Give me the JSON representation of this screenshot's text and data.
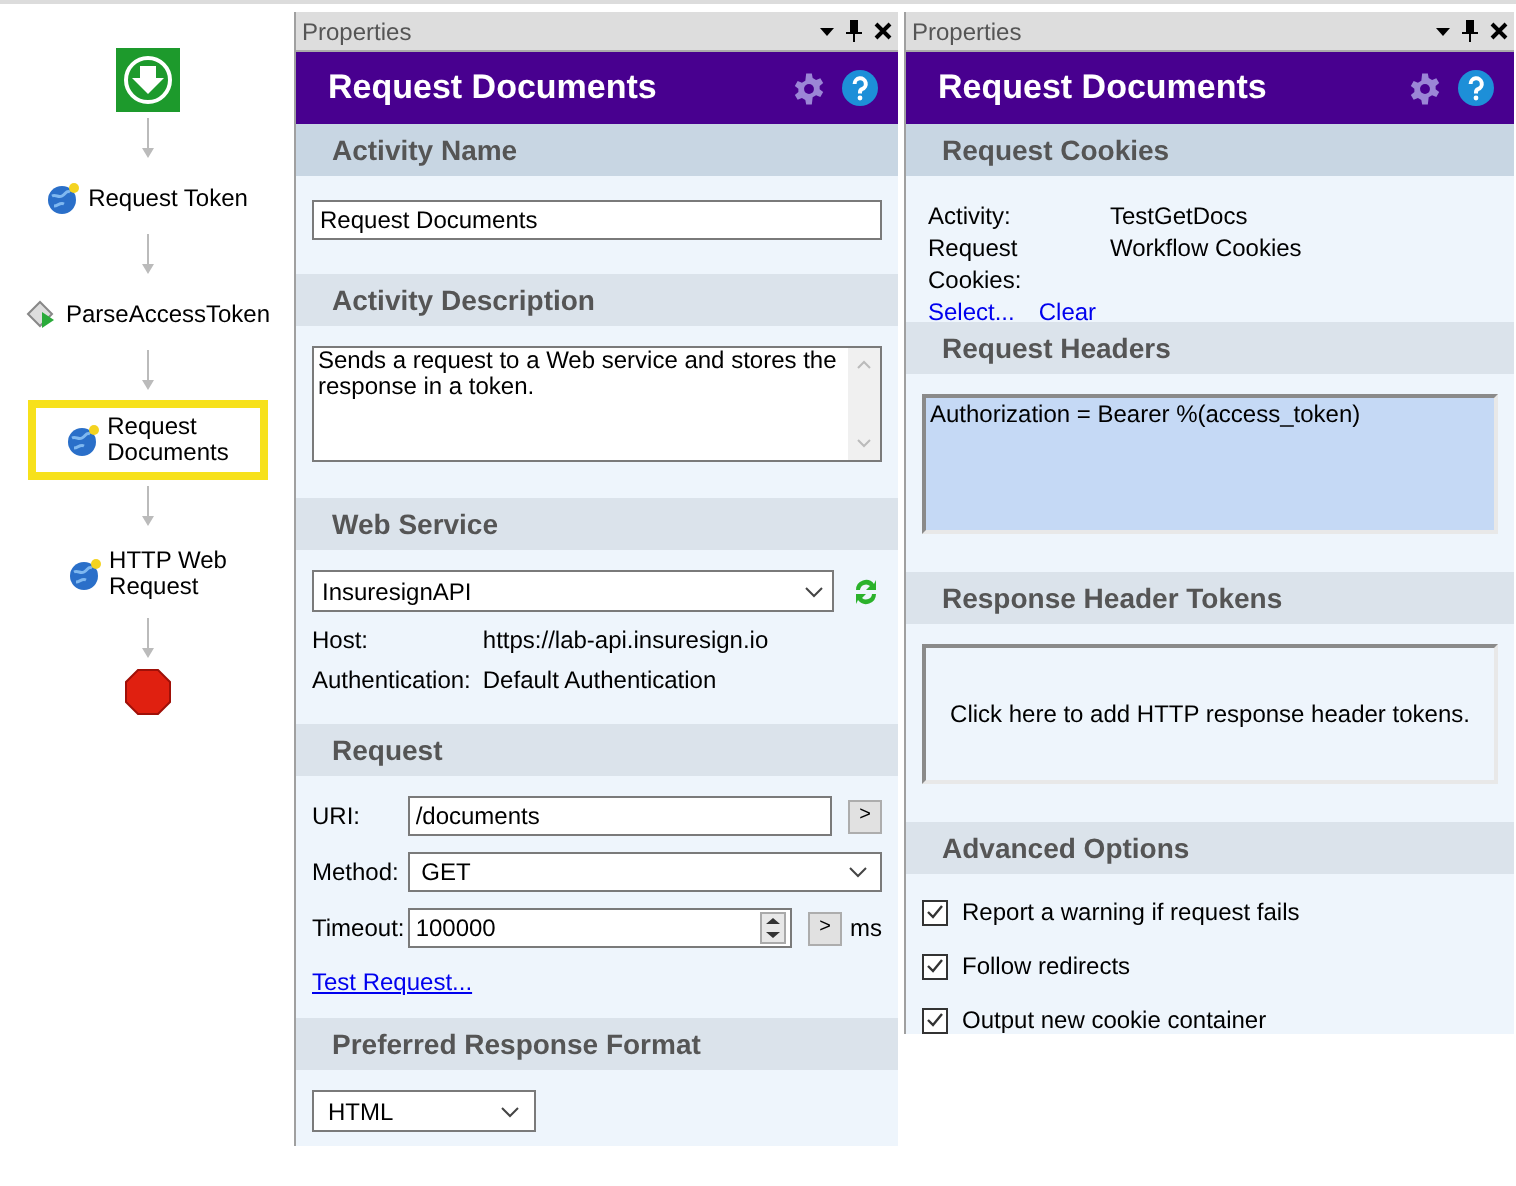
{
  "workflow": [
    {
      "kind": "start",
      "selected": false
    },
    {
      "kind": "web",
      "label": "Request Token",
      "selected": false
    },
    {
      "kind": "parse",
      "label": "ParseAccessToken",
      "selected": false
    },
    {
      "kind": "web",
      "label": "Request\nDocuments",
      "selected": true
    },
    {
      "kind": "web",
      "label": "HTTP Web\nRequest",
      "selected": false
    },
    {
      "kind": "stop",
      "selected": false
    }
  ],
  "panels": [
    {
      "titlebar": "Properties",
      "title": "Request Documents",
      "sections": [
        {
          "kind": "text_field",
          "heading": "Activity Name",
          "value": "Request Documents"
        },
        {
          "kind": "text_area",
          "heading": "Activity Description",
          "value": "Sends a request to a Web service and stores the response in a token."
        },
        {
          "kind": "web_service",
          "heading": "Web Service",
          "service": "InsuresignAPI",
          "fields": [
            {
              "label": "Host:",
              "value": "https://lab-api.insuresign.io"
            },
            {
              "label": "Authentication:",
              "value": "Default Authentication"
            }
          ]
        },
        {
          "kind": "request",
          "heading": "Request",
          "uri_label": "URI:",
          "uri": "/documents",
          "uri_button": ">",
          "method_label": "Method:",
          "method": "GET",
          "timeout_label": "Timeout:",
          "timeout": "100000",
          "timeout_button": ">",
          "timeout_unit": "ms",
          "link": "Test Request..."
        },
        {
          "kind": "format",
          "heading": "Preferred Response Format",
          "value": "HTML"
        }
      ]
    },
    {
      "titlebar": "Properties",
      "title": "Request Documents",
      "sections": [
        {
          "kind": "cookies",
          "heading": "Request Cookies",
          "fields": [
            {
              "label": "Activity:",
              "value": "TestGetDocs"
            },
            {
              "label": "Request Cookies:",
              "value": "Workflow Cookies"
            }
          ],
          "links": [
            "Select...",
            "Clear"
          ]
        },
        {
          "kind": "list_box",
          "heading": "Request Headers",
          "items": [
            "Authorization = Bearer %(access_token)"
          ]
        },
        {
          "kind": "prompt_box",
          "heading": "Response Header Tokens",
          "prompt": "Click here to add HTTP response header tokens."
        },
        {
          "kind": "checkboxes",
          "heading": "Advanced Options",
          "items": [
            {
              "label": "Report a warning if request fails",
              "checked": true
            },
            {
              "label": "Follow redirects",
              "checked": true
            },
            {
              "label": "Output new cookie container",
              "checked": true
            }
          ]
        }
      ]
    }
  ]
}
